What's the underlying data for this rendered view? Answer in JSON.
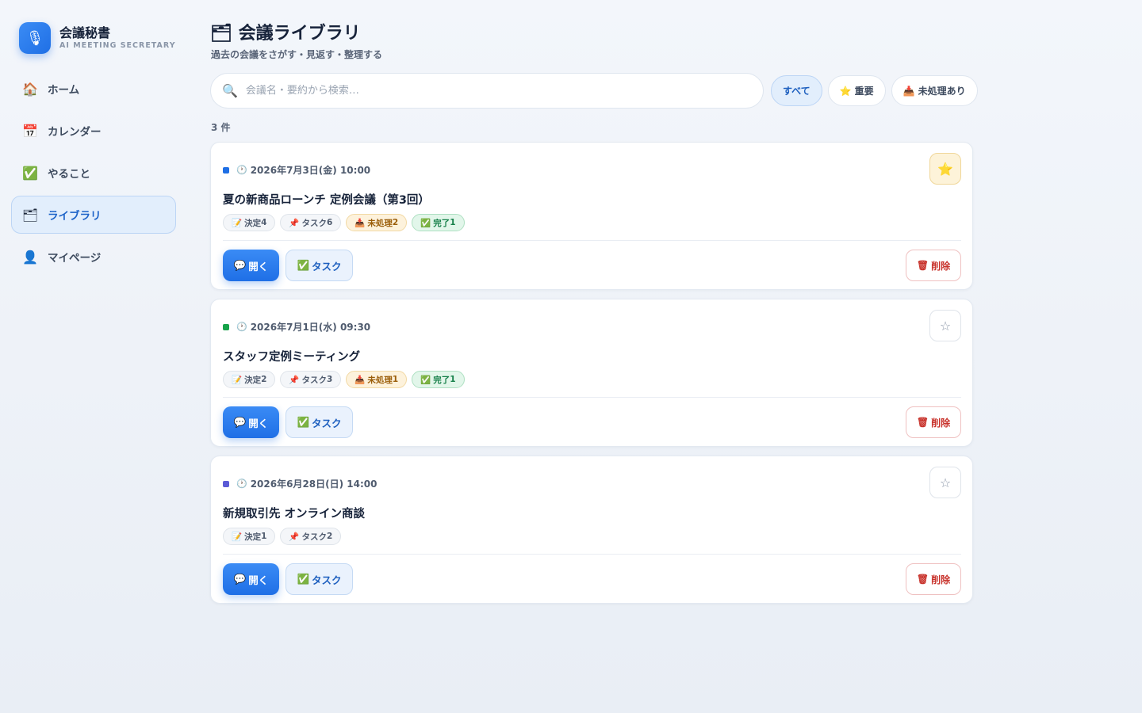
{
  "brand": {
    "logo_icon": "microphone-icon",
    "title": "会議秘書",
    "subtitle": "AI MEETING SECRETARY"
  },
  "nav": [
    {
      "icon": "🏠",
      "icon_name": "home-icon",
      "label": "ホーム",
      "active": false
    },
    {
      "icon": "📅",
      "icon_name": "calendar-icon",
      "label": "カレンダー",
      "active": false
    },
    {
      "icon": "✅",
      "icon_name": "check-icon",
      "label": "やること",
      "active": false
    },
    {
      "icon": "🗂",
      "icon_name": "folder-icon",
      "label": "ライブラリ",
      "active": true
    },
    {
      "icon": "👤",
      "icon_name": "user-icon",
      "label": "マイページ",
      "active": false
    }
  ],
  "page": {
    "title": "🗂 会議ライブラリ",
    "subtitle": "過去の会議をさがす・見返す・整理する"
  },
  "search": {
    "placeholder": "会議名・要約から検索…",
    "value": ""
  },
  "filters": [
    {
      "icon": "",
      "label": "すべて",
      "active": true
    },
    {
      "icon": "⭐",
      "label": "重要",
      "active": false
    },
    {
      "icon": "📥",
      "label": "未処理あり",
      "active": false
    }
  ],
  "count": "3 件",
  "labels": {
    "open": "開く",
    "task": "タスク",
    "delete": "削除"
  },
  "meetings": [
    {
      "dot_color": "#1f6fe5",
      "date": "2026年7月3日(金) 10:00",
      "title": "夏の新商品ローンチ 定例会議（第3回）",
      "starred": true,
      "badges": [
        {
          "type": "default",
          "icon": "📝",
          "label": "決定",
          "value": "4"
        },
        {
          "type": "default",
          "icon": "📌",
          "label": "タスク",
          "value": "6"
        },
        {
          "type": "pending",
          "icon": "📥",
          "label": "未処理",
          "value": "2"
        },
        {
          "type": "done",
          "icon": "✅",
          "label": "完了",
          "value": "1"
        }
      ]
    },
    {
      "dot_color": "#16a34a",
      "date": "2026年7月1日(水) 09:30",
      "title": "スタッフ定例ミーティング",
      "starred": false,
      "badges": [
        {
          "type": "default",
          "icon": "📝",
          "label": "決定",
          "value": "2"
        },
        {
          "type": "default",
          "icon": "📌",
          "label": "タスク",
          "value": "3"
        },
        {
          "type": "pending",
          "icon": "📥",
          "label": "未処理",
          "value": "1"
        },
        {
          "type": "done",
          "icon": "✅",
          "label": "完了",
          "value": "1"
        }
      ]
    },
    {
      "dot_color": "#5b5bd6",
      "date": "2026年6月28日(日) 14:00",
      "title": "新規取引先 オンライン商談",
      "starred": false,
      "badges": [
        {
          "type": "default",
          "icon": "📝",
          "label": "決定",
          "value": "1"
        },
        {
          "type": "default",
          "icon": "📌",
          "label": "タスク",
          "value": "2"
        }
      ]
    }
  ]
}
